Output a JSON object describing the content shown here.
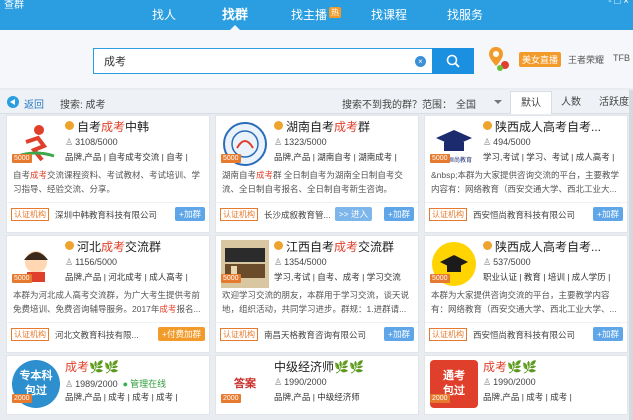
{
  "topbar": {
    "app_title": "查群",
    "nav": [
      {
        "label": "找人",
        "active": false
      },
      {
        "label": "找群",
        "active": true
      },
      {
        "label": "找主播",
        "active": false,
        "hot": "热"
      },
      {
        "label": "找课程",
        "active": false
      },
      {
        "label": "找服务",
        "active": false
      }
    ],
    "right_text": "- □ ×"
  },
  "search": {
    "query": "成考",
    "live_badge": "美女直播",
    "game_link": "王者荣耀",
    "tfb_link": "TFB"
  },
  "filter": {
    "back_label": "返回",
    "search_echo": "搜索: 成考",
    "not_found": "搜索不到我的群？",
    "range_label": "范围：",
    "range_value": "全国",
    "sort_tabs": [
      "默认",
      "人数",
      "活跃度"
    ]
  },
  "cards": [
    {
      "name_prefix": "自考",
      "name_hl": "成考",
      "name_suffix": "中韩",
      "members": "3108/5000",
      "tags": "品牌,产品 | 自考成考交流 | 自考 |",
      "desc_pre": "自考",
      "desc_hl": "成考",
      "desc_post": "交流课程资料、考试教材、考试培训、学习指导、经验交流、分享。",
      "cert": "认证机构",
      "org": "深圳中韩教育科技有限公司",
      "join": "+加群",
      "level": "5000",
      "avatar": "runner",
      "verified": true
    },
    {
      "name_prefix": "湖南自考",
      "name_hl": "成考",
      "name_suffix": "群",
      "members": "1323/5000",
      "tags": "品牌,产品 | 湖南自考 | 湖南成考 |",
      "desc_pre": "湖南自考",
      "desc_hl": "成考",
      "desc_post": "群 全日制自考为湖南全日制自考交流、全日制自考报名、全日制自考新生咨询。",
      "cert": "认证机构",
      "org": "长沙成叙教育管...",
      "enter": ">> 进入",
      "join": "+加群",
      "level": "5000",
      "avatar": "emblem",
      "verified": true
    },
    {
      "name_prefix": "陕西成人高考自考...",
      "name_hl": "",
      "name_suffix": "",
      "members": "494/5000",
      "tags": "学习,考试 | 学习、考试 | 成人高考 |",
      "desc_pre": "&nbsp;本群为大家提供咨询交流的平台，主要教学内容有：网络教育（西安交通大学、西北工业大...",
      "desc_hl": "",
      "desc_post": "",
      "cert": "认证机构",
      "org": "西安恒尚教育科技有限公司",
      "join": "+加群",
      "level": "5000",
      "avatar": "cap",
      "verified": true
    },
    {
      "name_prefix": "河北",
      "name_hl": "成考",
      "name_suffix": "交流群",
      "members": "1156/5000",
      "tags": "品牌,产品 | 河北成考 | 成人高考 |",
      "desc_pre": "本群为河北成人高考交流群，为广大考生提供考前免费培训、免费咨询辅导服务。2017年",
      "desc_hl": "成考",
      "desc_post": "报名...",
      "cert": "认证机构",
      "org": "河北文教育科技有限...",
      "join": "+付费加群",
      "join_orange": true,
      "level": "5000",
      "avatar": "girl",
      "verified": true
    },
    {
      "name_prefix": "江西自考",
      "name_hl": "成考",
      "name_suffix": "交流群",
      "members": "1354/5000",
      "tags": "学习,考试 | 自考、成考 | 学习交流",
      "desc_pre": "欢迎学习交流的朋友，本群用于学习交流，谈天说地，组织活动，共同学习进步。群规：1.进群请...",
      "desc_hl": "",
      "desc_post": "",
      "cert": "认证机构",
      "org": "南昌天格教育咨询有限公司",
      "join": "+加群",
      "level": "5000",
      "avatar": "books",
      "verified": true
    },
    {
      "name_prefix": "陕西成人高考自考...",
      "name_hl": "",
      "name_suffix": "",
      "members": "537/5000",
      "tags": "职业认证 | 教育 | 培训 | 成人学历 |",
      "desc_pre": "本群为大家提供咨询交流的平台，主要教学内容有：网络教育（西安交通大学、西北工业大学、...",
      "desc_hl": "",
      "desc_post": "",
      "cert": "认证机构",
      "org": "西安恒尚教育科技有限公司",
      "join": "+加群",
      "level": "5000",
      "avatar": "yellowcap",
      "verified": true
    },
    {
      "name_prefix": "",
      "name_hl": "成考",
      "name_suffix": "🌿🌿",
      "members": "1989/2000",
      "online": "管理在线",
      "tags": "品牌,产品 | 成考 | 成考 | 成考 |",
      "desc_pre": "",
      "desc_hl": "",
      "desc_post": "",
      "level": "2000",
      "avatar": "text1",
      "avatar_text": "专本科\n包过",
      "verified": false
    },
    {
      "name_prefix": "中级经济师",
      "name_hl": "",
      "name_suffix": "🌿🌿",
      "members": "1990/2000",
      "tags": "品牌,产品 | 中级经济师",
      "desc_pre": "",
      "desc_hl": "",
      "desc_post": "",
      "level": "2000",
      "avatar": "text2",
      "avatar_text": "答案",
      "verified": false
    },
    {
      "name_prefix": "",
      "name_hl": "成考",
      "name_suffix": "🌿🌿",
      "members": "1990/2000",
      "tags": "品牌,产品 | 成考 | 成考 |",
      "desc_pre": "",
      "desc_hl": "",
      "desc_post": "",
      "level": "2000",
      "avatar": "text3",
      "avatar_text": "通考\n包过",
      "verified": false
    }
  ]
}
